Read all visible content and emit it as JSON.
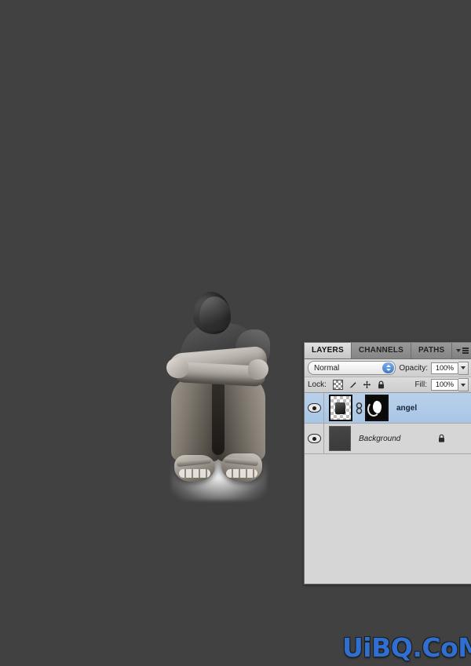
{
  "canvas": {
    "background_color": "#414141",
    "artwork": {
      "description": "grayscale photo of a seated person with arms crossed over knees, head lowered",
      "glow_color": "#ffffff"
    }
  },
  "layers_panel": {
    "tabs": [
      {
        "label": "LAYERS",
        "active": true
      },
      {
        "label": "CHANNELS",
        "active": false
      },
      {
        "label": "PATHS",
        "active": false
      }
    ],
    "panel_menu_icon": "panel-menu-icon",
    "blend_mode": {
      "value": "Normal",
      "stepper_color": "#3e7bc8"
    },
    "opacity": {
      "label": "Opacity:",
      "value": "100%"
    },
    "lock": {
      "label": "Lock:",
      "icons": [
        "lock-transparent-pixels-icon",
        "lock-image-pixels-icon",
        "lock-position-icon",
        "lock-all-icon"
      ]
    },
    "fill": {
      "label": "Fill:",
      "value": "100%"
    },
    "layers": [
      {
        "name": "angel",
        "visible": true,
        "selected": true,
        "has_mask": true,
        "linked": true,
        "locked": false,
        "italic": false
      },
      {
        "name": "Background",
        "visible": true,
        "selected": false,
        "has_mask": false,
        "linked": false,
        "locked": true,
        "italic": true
      }
    ]
  },
  "watermark": {
    "text": "UiBQ.CoM",
    "color": "#2f6fd0"
  }
}
